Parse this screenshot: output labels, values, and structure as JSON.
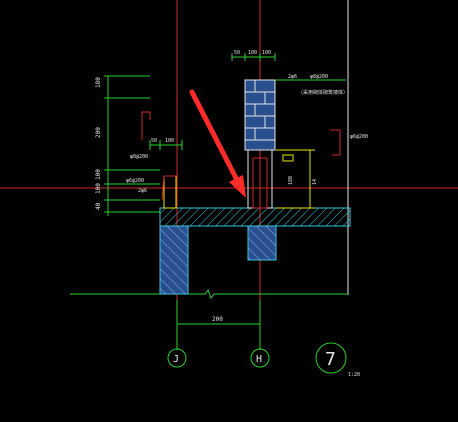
{
  "colors": {
    "background": "#000000",
    "red_line": "#cc2a2a",
    "white_line": "#e6e6e6",
    "green_dim": "#2ad12a",
    "yellow": "#e6e600",
    "cyan_hatch": "#37c6df",
    "blue_fill": "#4e7fbf",
    "arrow": "#ff2a2a"
  },
  "left_detail": {
    "dims_vertical": [
      "180",
      "200",
      "100",
      "100",
      "40"
    ],
    "dims_top": [
      "50",
      "100"
    ],
    "rebar_labels": [
      "φ8@200",
      "φ6@200",
      "2φ6"
    ]
  },
  "right_detail": {
    "dims_top": [
      "50",
      "100",
      "100"
    ],
    "rebar_labels": [
      "φ8@200",
      "2φ6",
      "φ6@200"
    ],
    "note": "（采用砌体砌筑墙体）",
    "small_labels": [
      "180",
      "14"
    ]
  },
  "bottom_dimension": "200",
  "axis_labels": {
    "left": "J",
    "right": "H"
  },
  "section_marker": {
    "number": "7",
    "scale": "1:20"
  },
  "icons": {
    "pointer": "red-arrow-icon"
  }
}
